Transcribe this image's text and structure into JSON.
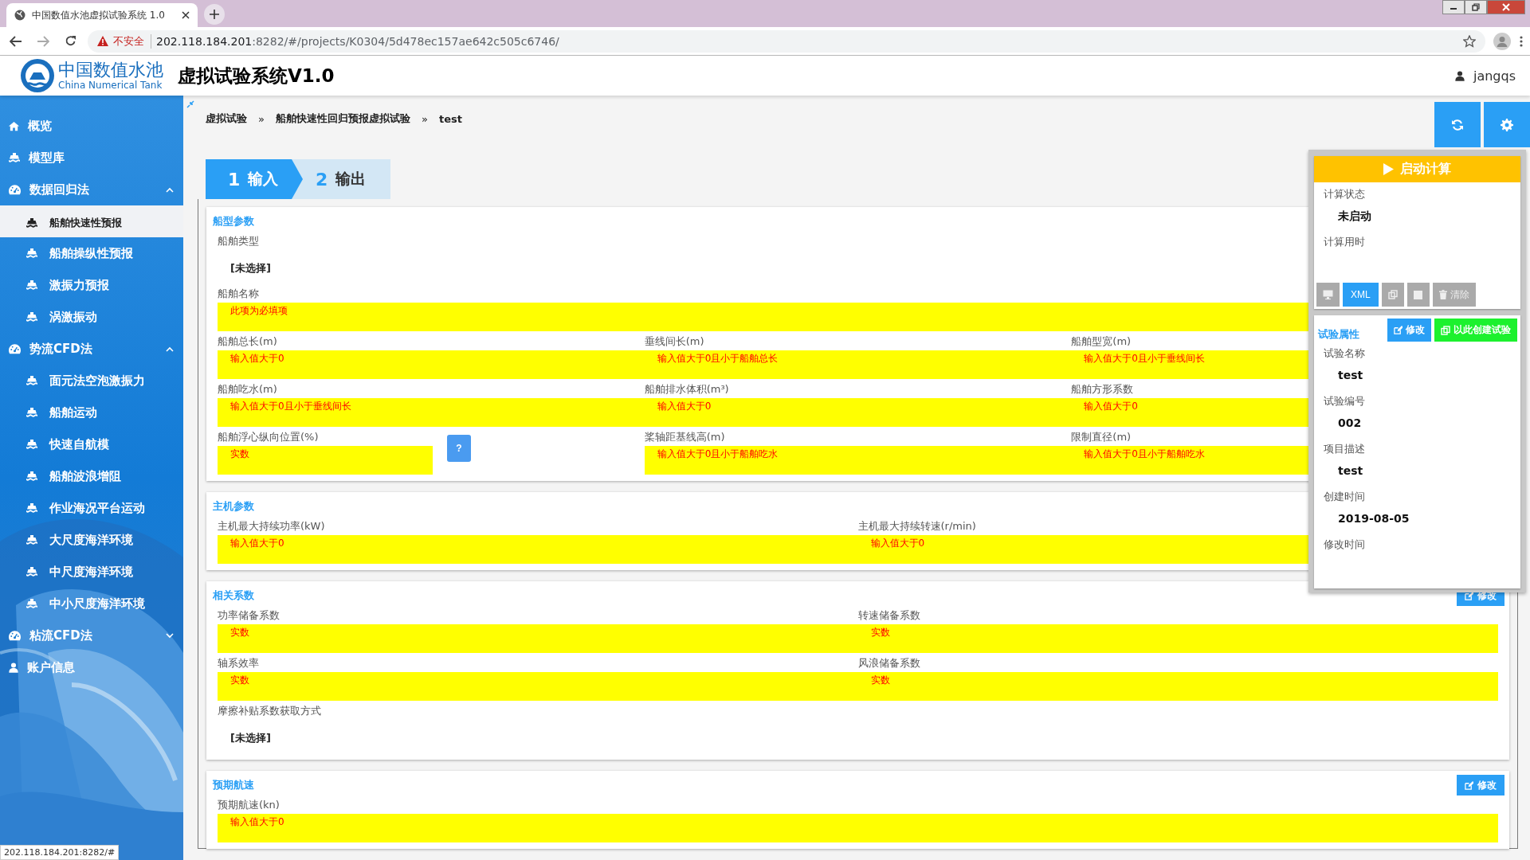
{
  "browser": {
    "tab_title": "中国数值水池虚拟试验系统 1.0",
    "insecure_label": "不安全",
    "url_host": "202.118.184.201",
    "url_rest": ":8282/#/projects/K0304/5d478ec157ae642c505c6746/"
  },
  "header": {
    "logo_cn": "中国数值水池",
    "logo_en": "China Numerical Tank",
    "title": "虚拟试验系统V1.0",
    "user": "jangqs"
  },
  "sidebar": {
    "items": [
      {
        "label": "概览",
        "kind": "home",
        "selected": false
      },
      {
        "label": "模型库",
        "kind": "ship",
        "selected": false
      },
      {
        "label": "数据回归法",
        "kind": "group",
        "expanded": true,
        "children": [
          {
            "label": "船舶快速性预报",
            "selected": true
          },
          {
            "label": "船舶操纵性预报",
            "selected": false
          },
          {
            "label": "激振力预报",
            "selected": false
          },
          {
            "label": "涡激振动",
            "selected": false
          }
        ]
      },
      {
        "label": "势流CFD法",
        "kind": "group",
        "expanded": true,
        "children": [
          {
            "label": "面元法空泡激振力",
            "selected": false
          },
          {
            "label": "船舶运动",
            "selected": false
          },
          {
            "label": "快速自航模",
            "selected": false
          },
          {
            "label": "船舶波浪增阻",
            "selected": false
          },
          {
            "label": "作业海况平台运动",
            "selected": false
          },
          {
            "label": "大尺度海洋环境",
            "selected": false
          },
          {
            "label": "中尺度海洋环境",
            "selected": false
          },
          {
            "label": "中小尺度海洋环境",
            "selected": false
          }
        ]
      },
      {
        "label": "粘流CFD法",
        "kind": "group",
        "expanded": false
      },
      {
        "label": "账户信息",
        "kind": "user",
        "selected": false
      }
    ]
  },
  "breadcrumb": {
    "items": [
      "虚拟试验",
      "船舶快速性回归预报虚拟试验",
      "test"
    ],
    "separators": [
      "»",
      "»"
    ]
  },
  "steps": [
    {
      "number": "1",
      "label": "输入",
      "selected": true
    },
    {
      "number": "2",
      "label": "输出",
      "selected": false
    }
  ],
  "sections": [
    {
      "title": "船型参数",
      "rows": [
        [
          {
            "kind": "select",
            "label": "船舶类型",
            "value": "[未选择]"
          }
        ],
        [
          {
            "kind": "input",
            "label": "船舶名称",
            "placeholder": "此项为必填项"
          }
        ],
        [
          {
            "kind": "input",
            "label": "船舶总长(m)",
            "placeholder": "输入值大于0"
          },
          {
            "kind": "input",
            "label": "垂线间长(m)",
            "placeholder": "输入值大于0且小于船舶总长"
          },
          {
            "kind": "input",
            "label": "船舶型宽(m)",
            "placeholder": "输入值大于0且小于垂线间长"
          }
        ],
        [
          {
            "kind": "input",
            "label": "船舶吃水(m)",
            "placeholder": "输入值大于0且小于垂线间长"
          },
          {
            "kind": "input",
            "label": "船舶排水体积(m³)",
            "placeholder": "输入值大于0"
          },
          {
            "kind": "input",
            "label": "船舶方形系数",
            "placeholder": "输入值大于0"
          }
        ],
        [
          {
            "kind": "input",
            "label": "船舶浮心纵向位置(%)",
            "placeholder": "实数",
            "help": "?"
          },
          {
            "kind": "input",
            "label": "桨轴距基线高(m)",
            "placeholder": "输入值大于0且小于船舶吃水"
          },
          {
            "kind": "input",
            "label": "限制直径(m)",
            "placeholder": "输入值大于0且小于船舶吃水"
          }
        ]
      ]
    },
    {
      "title": "主机参数",
      "rows": [
        [
          {
            "kind": "input",
            "label": "主机最大持续功率(kW)",
            "placeholder": "输入值大于0"
          },
          {
            "kind": "input",
            "label": "主机最大持续转速(r/min)",
            "placeholder": "输入值大于0"
          }
        ]
      ]
    },
    {
      "title": "相关系数",
      "edit_button": "修改",
      "rows": [
        [
          {
            "kind": "input",
            "label": "功率储备系数",
            "placeholder": "实数"
          },
          {
            "kind": "input",
            "label": "转速储备系数",
            "placeholder": "实数"
          }
        ],
        [
          {
            "kind": "input",
            "label": "轴系效率",
            "placeholder": "实数"
          },
          {
            "kind": "input",
            "label": "风浪储备系数",
            "placeholder": "实数"
          }
        ],
        [
          {
            "kind": "select",
            "label": "摩擦补贴系数获取方式",
            "value": "[未选择]"
          }
        ]
      ]
    },
    {
      "title": "预期航速",
      "edit_button": "修改",
      "rows": [
        [
          {
            "kind": "input",
            "label": "预期航速(kn)",
            "placeholder": "输入值大于0"
          }
        ]
      ]
    }
  ],
  "panel": {
    "run_button": "启动计算",
    "status": [
      {
        "label": "计算状态",
        "value": "未启动"
      },
      {
        "label": "计算用时"
      }
    ],
    "toolbar": [
      {
        "kind": "monitor",
        "disabled": true
      },
      {
        "kind": "text",
        "label": "XML",
        "disabled": false
      },
      {
        "kind": "copy",
        "disabled": true
      },
      {
        "kind": "stop",
        "disabled": true
      },
      {
        "kind": "trash",
        "label": "清除",
        "disabled": true
      }
    ],
    "properties": {
      "title": "试验属性",
      "buttons": [
        {
          "label": "修改",
          "kind": "edit"
        },
        {
          "label": "以此创建试验",
          "kind": "create"
        }
      ],
      "fields": [
        {
          "label": "试验名称",
          "value": "test"
        },
        {
          "label": "试验编号",
          "value": "002"
        },
        {
          "label": "项目描述",
          "value": "test"
        },
        {
          "label": "创建时间",
          "value": "2019-08-05"
        },
        {
          "label": "修改时间"
        }
      ]
    }
  },
  "status_url": "202.118.184.201:8282/#"
}
